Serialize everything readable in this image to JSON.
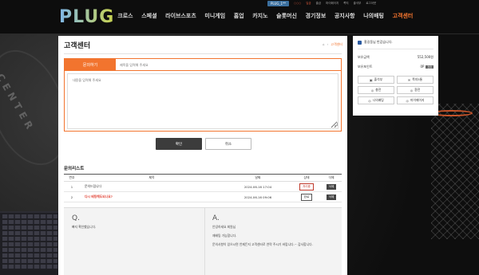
{
  "topbar": {
    "user": "PLUG_1**",
    "links": [
      "○○○",
      "입금",
      "출금",
      "마이페이지",
      "쪽지",
      "출석부",
      "로그아웃"
    ]
  },
  "logo": "PLUG",
  "nav": [
    "크로스",
    "스페셜",
    "라이브스포츠",
    "미니게임",
    "홈업",
    "카지노",
    "슬롯머신",
    "경기정보",
    "공지사항",
    "나의배팅",
    "고객센터"
  ],
  "nav_active": "고객센터",
  "page": {
    "title": "고객센터",
    "crumb_home": "⌂",
    "crumb_current": "고객센터"
  },
  "form": {
    "tab": "문의하기",
    "subject_placeholder": "제목을 입력해 주세요",
    "content_placeholder": "내용을 입력해 주세요",
    "confirm": "확인",
    "cancel": "취소"
  },
  "list": {
    "title": "문의리스트",
    "headers": {
      "no": "번호",
      "title": "제목",
      "date": "날짜",
      "state": "상태",
      "del": "삭제"
    },
    "rows": [
      {
        "no": "1",
        "title": "문의드립니다",
        "date": "2024-06-16 17:04",
        "state": "처리중",
        "del": "삭제"
      },
      {
        "no": "2",
        "title": "다시 배팅해도되나요?",
        "date": "2024-06-16 09:06",
        "state": "완료",
        "del": "삭제"
      }
    ]
  },
  "qa": {
    "q_label": "Q.",
    "question": "빠지 확인했습니다.",
    "a_label": "A.",
    "answer_lines": [
      "안녕하세요 회원님",
      "재배팅 가능합니다.",
      "문의사항이 있으시면 언제든지 고객센터로 연락 주시기 바랍니다.~ 감사합니다."
    ]
  },
  "side": {
    "greeting": "홍길동님 반갑습니다.",
    "balance_label": "보유금액",
    "balance_value": "552,500원",
    "point_label": "보유포인트",
    "point_value": "0P",
    "point_btn": "전환",
    "buttons": [
      {
        "icon": "▣",
        "label": "출석부"
      },
      {
        "icon": "✉",
        "label": "쪽지5통"
      },
      {
        "icon": "◎",
        "label": "충전"
      },
      {
        "icon": "◎",
        "label": "환전"
      },
      {
        "icon": "◎",
        "label": "나의배팅"
      },
      {
        "icon": "◎",
        "label": "마이페이지"
      }
    ]
  },
  "colors": {
    "accent": "#f2742e",
    "dark": "#0d0d0d",
    "alert": "#e2473a"
  }
}
